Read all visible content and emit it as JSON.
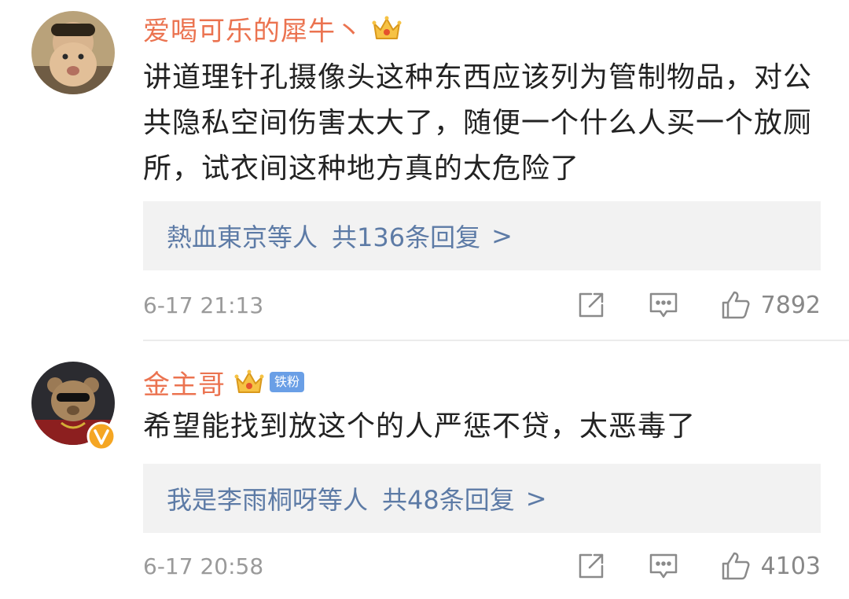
{
  "comments": [
    {
      "username": "爱喝可乐的犀牛丶",
      "badge": "crown-icon",
      "content": "讲道理针孔摄像头这种东西应该列为管制物品，对公共隐私空间伤害太大了，随便一个什么人买一个放厕所，试衣间这种地方真的太危险了",
      "reply_names": "熱血東京等人",
      "reply_count": "共136条回复",
      "reply_chevron": ">",
      "timestamp": "6-17 21:13",
      "likes": "7892"
    },
    {
      "username": "金主哥",
      "badge": "crown-icon",
      "fan_badge": "铁粉",
      "content": "希望能找到放这个的人严惩不贷，太恶毒了",
      "reply_names": "我是李雨桐呀等人",
      "reply_count": "共48条回复",
      "reply_chevron": ">",
      "timestamp": "6-17 20:58",
      "likes": "4103"
    }
  ],
  "colors": {
    "username": "#eb7350",
    "reply_link": "#5d7ba6",
    "reply_bg": "#f2f2f2",
    "meta_text": "#9a9a9a",
    "icon": "#8a8a8a",
    "fan_badge_bg": "#6a9fe6",
    "verified_badge": "#f5a623"
  }
}
